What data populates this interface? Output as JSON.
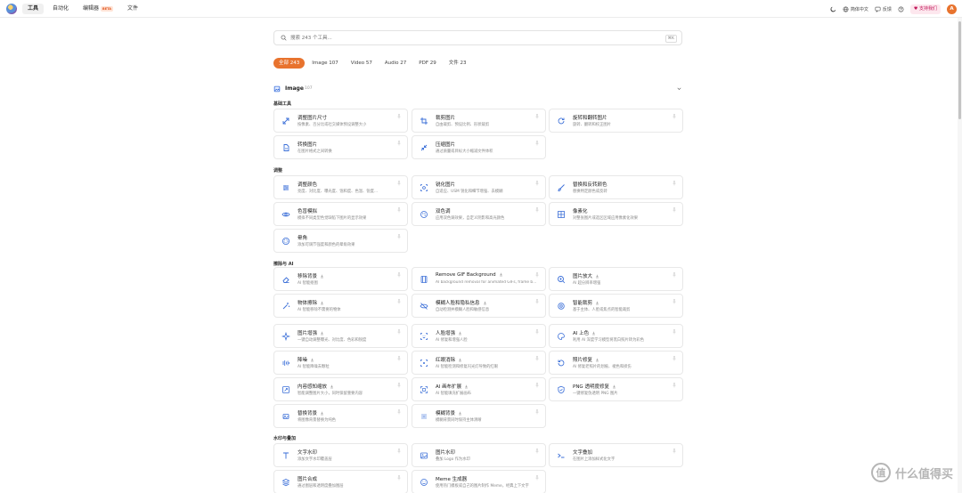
{
  "nav": {
    "items": [
      {
        "label": "工具",
        "active": true
      },
      {
        "label": "自动化",
        "active": false
      },
      {
        "label": "编辑器",
        "active": false,
        "badge": "BETA"
      },
      {
        "label": "文件",
        "active": false
      }
    ]
  },
  "right": {
    "lang": "简体中文",
    "feedback": "反馈",
    "support": "支持我们",
    "avatar": "A"
  },
  "search": {
    "placeholder": "搜索 243 个工具...",
    "shortcut": "⌘K"
  },
  "filters": [
    {
      "label": "全部 243",
      "active": true
    },
    {
      "label": "Image 107",
      "active": false
    },
    {
      "label": "Video 57",
      "active": false
    },
    {
      "label": "Audio 27",
      "active": false
    },
    {
      "label": "PDF 29",
      "active": false
    },
    {
      "label": "文件 23",
      "active": false
    }
  ],
  "section": {
    "name": "Image",
    "count": "107"
  },
  "groups": {
    "basic": "基础工具",
    "adjust": "调整",
    "ai": "擦除与 AI",
    "watermark": "水印与叠加"
  },
  "cards": [
    {
      "title": "调整图片尺寸",
      "desc": "按像素、百分比或社交媒体预设调整大小",
      "icon": "resize-icon"
    },
    {
      "title": "裁剪图片",
      "desc": "自由裁剪、预设比例、形状裁剪",
      "icon": "crop-icon"
    },
    {
      "title": "旋转和翻转图片",
      "desc": "旋转、翻转和校正图片",
      "icon": "rotate-icon"
    },
    {
      "title": "转换图片",
      "desc": "在图片格式之间转换",
      "icon": "convert-icon"
    },
    {
      "title": "压缩图片",
      "desc": "通过质量或目标大小缩减文件体积",
      "icon": "compress-icon"
    },
    {
      "title": "调整颜色",
      "desc": "亮度、对比度、曝光度、饱和度、色温、锐度…",
      "icon": "sliders-icon"
    },
    {
      "title": "锐化图片",
      "desc": "自适应、USM 锐化和细节增强、去模糊",
      "icon": "sharpen-icon"
    },
    {
      "title": "替换和反转颜色",
      "desc": "替换特定颜色或反转",
      "icon": "brush-icon"
    },
    {
      "title": "色盲模拟",
      "desc": "模拟不同类型色觉缺陷下图片的显示效果",
      "icon": "eye-icon"
    },
    {
      "title": "双色调",
      "desc": "应用双色调效果，自定义阴影和高光颜色",
      "icon": "duotone-icon"
    },
    {
      "title": "像素化",
      "desc": "对整张图片或选区区域应用像素化效果",
      "icon": "grid-icon"
    },
    {
      "title": "晕角",
      "desc": "添加可调节强度和颜色的晕角效果",
      "icon": "vignette-icon"
    },
    {
      "title": "移除背景",
      "desc": "AI 智能抠图",
      "icon": "eraser-icon",
      "download": true
    },
    {
      "title": "Remove GIF Background",
      "desc": "AI background removal for animated GIFs, frame by frame",
      "icon": "film-icon",
      "download": true
    },
    {
      "title": "图片放大",
      "desc": "AI 超分辨率增强",
      "icon": "zoom-icon",
      "download": true
    },
    {
      "title": "物体擦除",
      "desc": "AI 智能移除不需要的物体",
      "icon": "wand-icon",
      "download": true
    },
    {
      "title": "模糊人脸和隐私信息",
      "desc": "自动检测并模糊人脸和敏感信息",
      "icon": "eye-off-icon",
      "download": true
    },
    {
      "title": "智能裁剪",
      "desc": "基于主体、人脸或焦点的智能裁剪",
      "icon": "target-icon",
      "download": true
    },
    {
      "title": "图片增强",
      "desc": "一键自动调整曝光、对比度、色彩和锐度",
      "icon": "sparkle-icon",
      "download": true
    },
    {
      "title": "人脸增强",
      "desc": "AI 修复和增强人脸",
      "icon": "face-icon",
      "download": true
    },
    {
      "title": "AI 上色",
      "desc": "利用 AI 深度学习模型将黑白照片转为彩色",
      "icon": "palette-icon",
      "download": true
    },
    {
      "title": "降噪",
      "desc": "AI 智能降噪去颗粒",
      "icon": "waves-icon",
      "download": true
    },
    {
      "title": "红眼消除",
      "desc": "AI 智能检测和修复闪光灯导致的红眼",
      "icon": "redeye-icon",
      "download": true
    },
    {
      "title": "照片修复",
      "desc": "AI 修复老照片的划痕、褪色和损伤",
      "icon": "restore-icon",
      "download": true
    },
    {
      "title": "内容感知缩放",
      "desc": "智能调整图片大小，同时保留重要内容",
      "icon": "scale-icon",
      "download": true
    },
    {
      "title": "AI 画布扩展",
      "desc": "AI 智能填充扩展画布",
      "icon": "expand-icon",
      "download": true
    },
    {
      "title": "PNG 透明度修复",
      "desc": "一键修复伪透明 PNG 图片",
      "icon": "shield-icon",
      "download": true
    },
    {
      "title": "替换背景",
      "desc": "将图像背景替换为纯色",
      "icon": "swap-icon",
      "download": true
    },
    {
      "title": "模糊背景",
      "desc": "模糊背景同时保持主体清晰",
      "icon": "blur-icon",
      "download": true
    },
    {
      "title": "文字水印",
      "desc": "添加文字水印覆盖层",
      "icon": "text-icon"
    },
    {
      "title": "图片水印",
      "desc": "叠加 Logo 作为水印",
      "icon": "image-icon"
    },
    {
      "title": "文字叠加",
      "desc": "在图片上添加样式化文字",
      "icon": "type-overlay-icon"
    },
    {
      "title": "图片合成",
      "desc": "通过图层和透明度叠加图层",
      "icon": "layers-icon"
    },
    {
      "title": "Meme 生成器",
      "desc": "使用热门模板或自己的图片制作 Meme，经典上下文字",
      "icon": "smile-icon"
    }
  ],
  "watermark": {
    "text": "什么值得买"
  },
  "colors": {
    "accent": "#e8732e",
    "iconBlue": "#3b6fd8",
    "pin": "#b8b8b8"
  }
}
